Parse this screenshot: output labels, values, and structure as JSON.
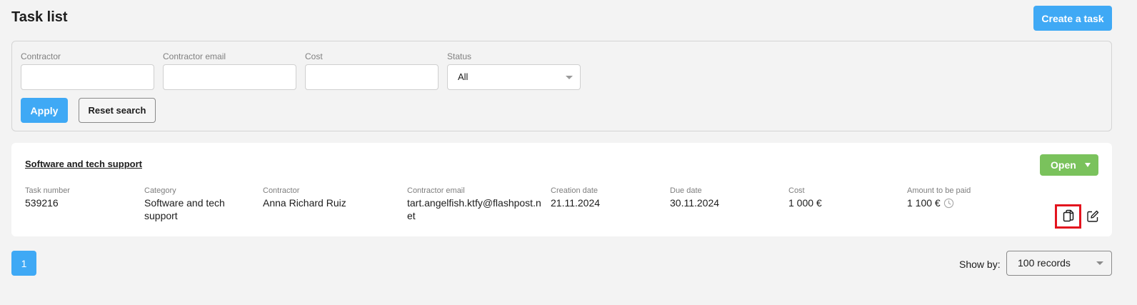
{
  "header": {
    "title": "Task list",
    "create_button": "Create a task"
  },
  "filters": {
    "contractor_label": "Contractor",
    "contractor_value": "",
    "email_label": "Contractor email",
    "email_value": "",
    "cost_label": "Cost",
    "cost_value": "",
    "status_label": "Status",
    "status_value": "All",
    "apply_button": "Apply",
    "reset_button": "Reset search"
  },
  "task": {
    "title": "Software and tech support",
    "status": "Open",
    "status_color": "#7ac25c",
    "columns": [
      {
        "label": "Task number",
        "value": "539216"
      },
      {
        "label": "Category",
        "value": "Software and tech support"
      },
      {
        "label": "Contractor",
        "value": "Anna Richard Ruiz"
      },
      {
        "label": "Contractor email",
        "value": "tart.angelfish.ktfy@flashpost.net"
      },
      {
        "label": "Creation date",
        "value": "21.11.2024"
      },
      {
        "label": "Due date",
        "value": "30.11.2024"
      },
      {
        "label": "Cost",
        "value": "1 000 €"
      },
      {
        "label": "Amount to be paid",
        "value": "1 100 €"
      }
    ],
    "actions": {
      "copy_icon": "copy-icon",
      "edit_icon": "edit-icon",
      "highlight_color": "#e3141e"
    }
  },
  "pagination": {
    "current_page": "1",
    "show_by_label": "Show by:",
    "show_by_value": "100 records"
  },
  "colors": {
    "accent": "#3fa9f5",
    "background": "#f3f3f3"
  }
}
